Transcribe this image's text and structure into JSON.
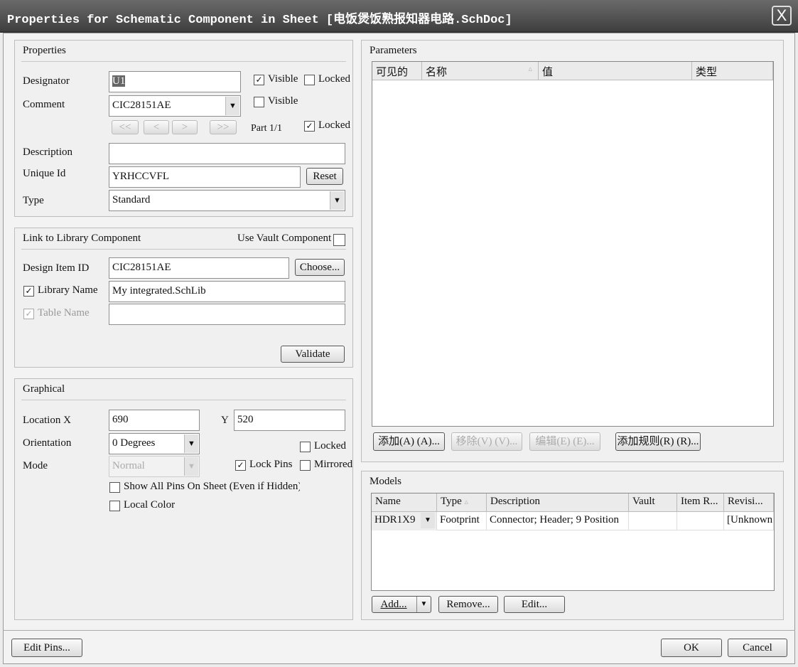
{
  "window": {
    "title": "Properties for Schematic Component in Sheet [电饭煲饭熟报知器电路.SchDoc]",
    "close": "X"
  },
  "properties": {
    "title": "Properties",
    "designator_label": "Designator",
    "designator": "U1",
    "visible1": "Visible",
    "locked1": "Locked",
    "comment_label": "Comment",
    "comment": "CIC28151AE",
    "visible2": "Visible",
    "nav": [
      "<<",
      "<",
      ">",
      ">>"
    ],
    "part": "Part 1/1",
    "locked2": "Locked",
    "description_label": "Description",
    "description": "",
    "unique_id_label": "Unique Id",
    "unique_id": "YRHCCVFL",
    "reset": "Reset",
    "type_label": "Type",
    "type": "Standard"
  },
  "link": {
    "title": "Link to Library Component",
    "use_vault": "Use Vault Component",
    "design_item_label": "Design Item ID",
    "design_item": "CIC28151AE",
    "choose": "Choose...",
    "library_name_label": "Library Name",
    "library_name": "My integrated.SchLib",
    "table_name_label": "Table Name",
    "table_name": "",
    "validate": "Validate"
  },
  "graphical": {
    "title": "Graphical",
    "location_label": "Location  X",
    "x": "690",
    "y_label": "Y",
    "y": "520",
    "orientation_label": "Orientation",
    "orientation": "0 Degrees",
    "locked": "Locked",
    "mode_label": "Mode",
    "mode": "Normal",
    "lock_pins": "Lock Pins",
    "mirrored": "Mirrored",
    "show_all_pins": "Show All Pins On Sheet (Even if Hidden)",
    "local_colors": "Local Colors"
  },
  "parameters": {
    "title": "Parameters",
    "columns": [
      "可见的",
      "名称",
      "值",
      "类型"
    ],
    "add": "添加(A) (A)...",
    "remove": "移除(V) (V)...",
    "edit": "编辑(E) (E)...",
    "add_rule": "添加规则(R) (R)..."
  },
  "models": {
    "title": "Models",
    "columns": [
      "Name",
      "Type",
      "Description",
      "Vault",
      "Item R...",
      "Revisi..."
    ],
    "rows": [
      [
        "HDR1X9",
        "Footprint",
        "Connector; Header; 9 Position",
        "",
        "",
        "[Unknown"
      ]
    ],
    "add": "Add...",
    "remove": "Remove...",
    "edit": "Edit..."
  },
  "footer": {
    "edit_pins": "Edit Pins...",
    "ok": "OK",
    "cancel": "Cancel"
  }
}
